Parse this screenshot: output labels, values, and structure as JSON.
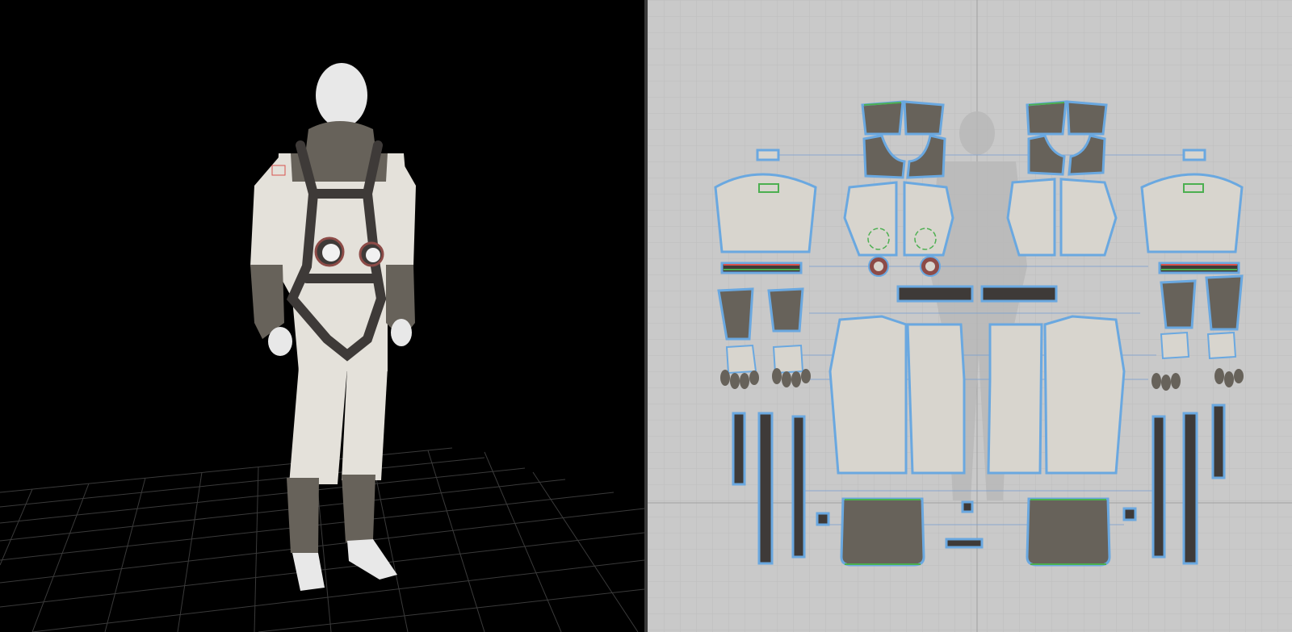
{
  "app": {
    "views": [
      {
        "id": "3d-view"
      },
      {
        "id": "2d-pattern-view"
      }
    ]
  },
  "colors": {
    "viewport_bg": "#000000",
    "floor_grid": "#3a3a3a",
    "pattern_bg": "#c9c9c9",
    "pattern_grid": "#bdbdbd",
    "fabric_light": "#d8d5ce",
    "fabric_dark": "#67625a",
    "strap": "#3e3a38",
    "outline_selected": "#6aa8e0",
    "seam_green": "#4caf50",
    "seam_red": "#d9534f"
  },
  "icons": {
    "avatar": "avatar-silhouette-icon"
  }
}
